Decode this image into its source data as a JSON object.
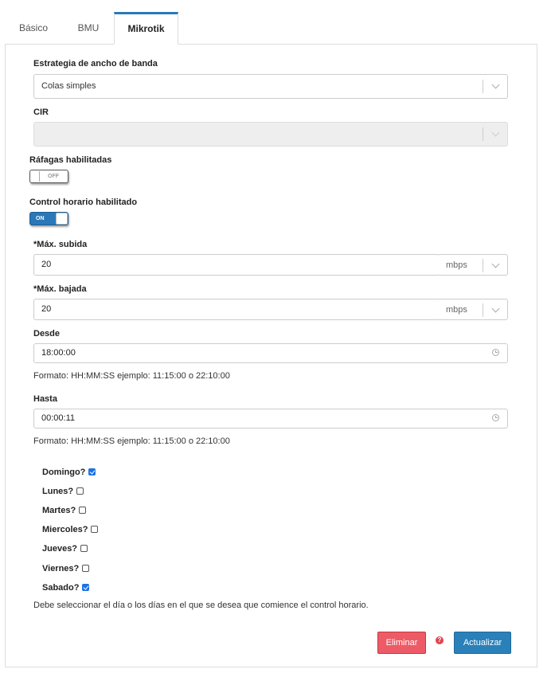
{
  "tabs": [
    {
      "label": "Básico"
    },
    {
      "label": "BMU"
    },
    {
      "label": "Mikrotik"
    }
  ],
  "form": {
    "bandwidth_strategy": {
      "label": "Estrategia de ancho de banda",
      "value": "Colas simples"
    },
    "cir": {
      "label": "CIR",
      "value": ""
    },
    "bursts": {
      "label": "Ráfagas habilitadas",
      "state": "OFF"
    },
    "schedule": {
      "label": "Control horario habilitado",
      "state": "ON"
    },
    "max_up": {
      "required": "*",
      "label": "Máx. subida",
      "value": "20",
      "unit": "mbps"
    },
    "max_down": {
      "required": "*",
      "label": "Máx. bajada",
      "value": "20",
      "unit": "mbps"
    },
    "from": {
      "label": "Desde",
      "value": "18:00:00",
      "help": "Formato: HH:MM:SS ejemplo: 11:15:00 o 22:10:00"
    },
    "to": {
      "label": "Hasta",
      "value": "00:00:11",
      "help": "Formato: HH:MM:SS ejemplo: 11:15:00 o 22:10:00"
    },
    "days": [
      {
        "label": "Domingo?",
        "checked": true
      },
      {
        "label": "Lunes?",
        "checked": false
      },
      {
        "label": "Martes?",
        "checked": false
      },
      {
        "label": "Miercoles?",
        "checked": false
      },
      {
        "label": "Jueves?",
        "checked": false
      },
      {
        "label": "Viernes?",
        "checked": false
      },
      {
        "label": "Sabado?",
        "checked": true
      }
    ],
    "days_help": "Debe seleccionar el día o los días en el que se desea que comience el control horario."
  },
  "actions": {
    "delete_label": "Eliminar",
    "help_icon": "question-circle-icon",
    "update_label": "Actualizar"
  },
  "colors": {
    "accent": "#2a78b8",
    "danger": "#ec5b66",
    "primary_button": "#2a80b9"
  }
}
